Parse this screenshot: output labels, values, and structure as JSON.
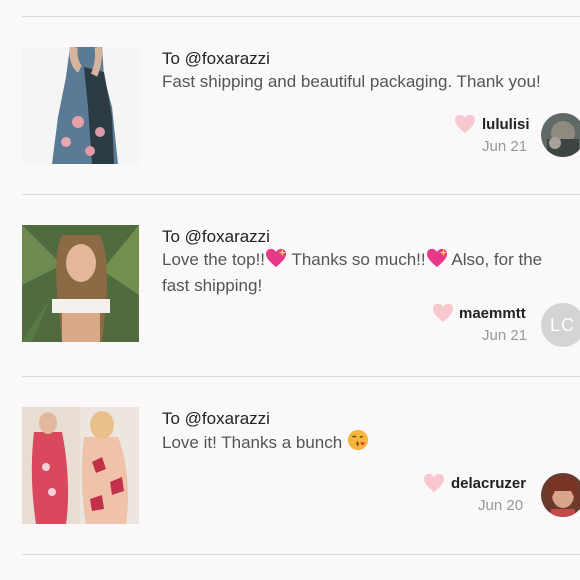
{
  "reviews": [
    {
      "to": "To @foxarazzi",
      "message_lines": [
        "Fast shipping and beautiful packaging. Thank you!"
      ],
      "username": "lululisi",
      "date": "Jun 21",
      "avatar_type": "photo",
      "thumbnail": "dress-photo"
    },
    {
      "to": "To @foxarazzi",
      "message_parts": [
        "Love the top!!",
        "heart-sparkle-emoji",
        " Thanks so much!!",
        "heart-sparkle-emoji",
        " Also, for the"
      ],
      "message_line2": "fast shipping!",
      "username": "maemmtt",
      "date": "Jun 21",
      "avatar_type": "initials",
      "avatar_initials": "LC",
      "thumbnail": "top-photo"
    },
    {
      "to": "To @foxarazzi",
      "message_parts": [
        "Love it! Thanks a bunch ",
        "kiss-emoji"
      ],
      "username": "delacruzer",
      "date": "Jun 20",
      "avatar_type": "photo",
      "thumbnail": "floral-dress-photo"
    }
  ],
  "colors": {
    "heart": "#f8c8cf",
    "divider": "#dcdcdc",
    "background": "#faf8f8"
  }
}
